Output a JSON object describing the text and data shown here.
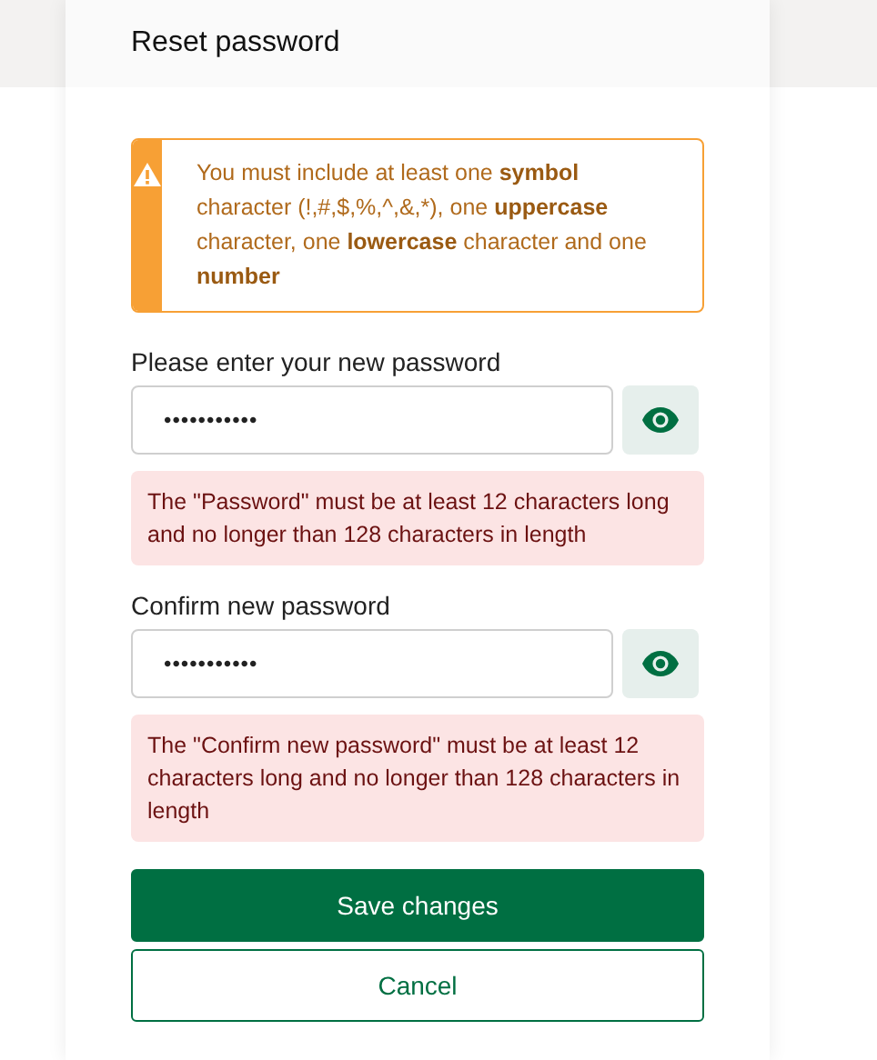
{
  "dialog": {
    "title": "Reset password"
  },
  "notice": {
    "kind": "warning",
    "text": "You must include at least one **symbol** character (!,#,$,%,^,&,*), one **uppercase** character, one **lowercase** character and one **number**"
  },
  "fields": [
    {
      "label": "Please enter your new password",
      "value": "•••••••••••",
      "error": "The \"Password\" must be at least 12 characters long and no longer than 128 characters in length"
    },
    {
      "label": "Confirm new password",
      "value": "•••••••••••",
      "error": "The \"Confirm new password\" must be at least 12 characters long and no longer than 128 characters in length"
    }
  ],
  "buttons": [
    {
      "label": "Save changes",
      "kind": "primary"
    },
    {
      "label": "Cancel",
      "kind": "secondary"
    }
  ]
}
